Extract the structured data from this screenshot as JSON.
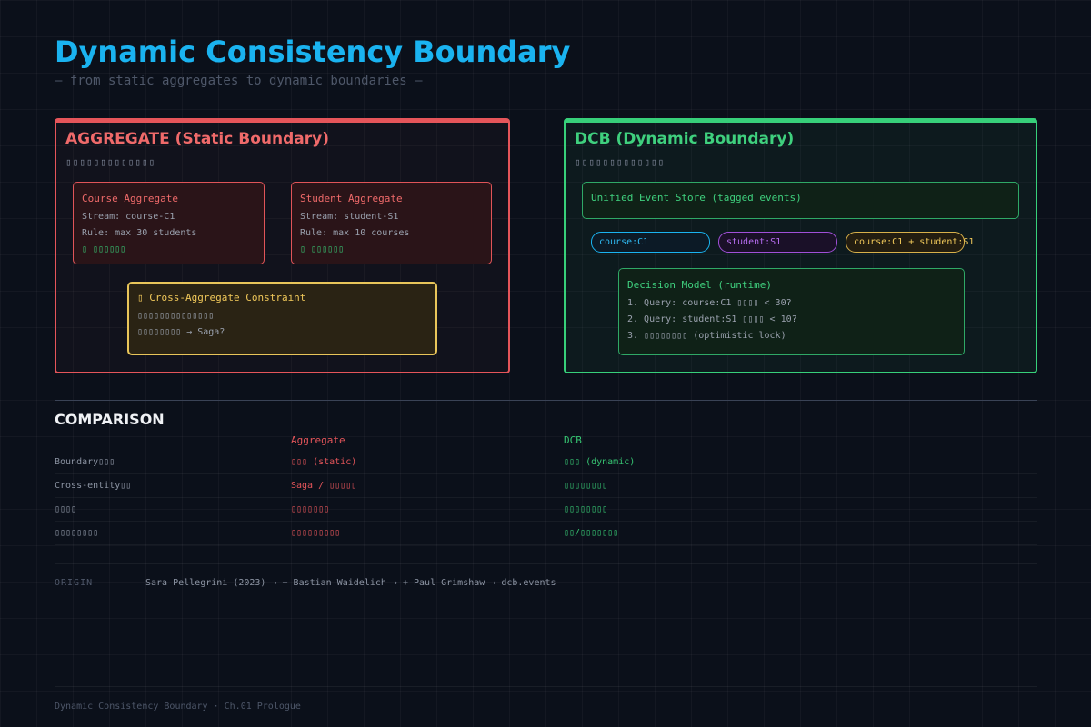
{
  "header": {
    "title": "Dynamic Consistency Boundary",
    "subtitle": "— from static aggregates to dynamic boundaries —"
  },
  "aggregate_panel": {
    "title": "AGGREGATE (Static Boundary)",
    "subtitle": "▯▯▯▯▯▯▯▯▯▯▯▯▯",
    "course": {
      "title": "Course Aggregate",
      "stream": "Stream: course-C1",
      "rule": "Rule: max 30 students",
      "status": "▯ ▯▯▯▯▯▯"
    },
    "student": {
      "title": "Student Aggregate",
      "stream": "Stream: student-S1",
      "rule": "Rule: max 10 courses",
      "status": "▯ ▯▯▯▯▯▯"
    },
    "constraint": {
      "title": "▯ Cross-Aggregate Constraint",
      "line1": "▯▯▯▯▯▯▯▯▯▯▯▯▯▯",
      "line2": "▯▯▯▯▯▯▯▯ → Saga?"
    }
  },
  "dcb_panel": {
    "title": "DCB (Dynamic Boundary)",
    "subtitle": "▯▯▯▯▯▯▯▯▯▯▯▯▯",
    "store": "Unified Event Store (tagged events)",
    "tags": [
      "course:C1",
      "student:S1",
      "course:C1 + student:S1"
    ],
    "decision": {
      "title": "Decision Model (runtime)",
      "step1": "1. Query: course:C1 ▯▯▯▯ < 30?",
      "step2": "2. Query: student:S1 ▯▯▯▯ < 10?",
      "step3": "3. ▯▯▯▯▯▯▯▯ (optimistic lock)"
    }
  },
  "comparison": {
    "title": "COMPARISON",
    "col_agg": "Aggregate",
    "col_dcb": "DCB",
    "rows": [
      {
        "label": "Boundary▯▯▯",
        "agg": "▯▯▯ (static)",
        "dcb": "▯▯▯ (dynamic)"
      },
      {
        "label": "Cross-entity▯▯",
        "agg": "Saga / ▯▯▯▯▯",
        "dcb": "▯▯▯▯▯▯▯▯"
      },
      {
        "label": "▯▯▯▯",
        "agg": "▯▯▯▯▯▯▯",
        "dcb": "▯▯▯▯▯▯▯▯"
      },
      {
        "label": "▯▯▯▯▯▯▯▯",
        "agg": "▯▯▯▯▯▯▯▯▯",
        "dcb": "▯▯/▯▯▯▯▯▯▯"
      }
    ]
  },
  "origin": {
    "label": "ORIGIN",
    "text": "Sara Pellegrini (2023) → + Bastian Waidelich → + Paul Grimshaw → dcb.events"
  },
  "footer": {
    "text": "Dynamic Consistency Boundary · Ch.01 Prologue"
  },
  "colors": {
    "accent": "#1ab3f0",
    "aggregate": "#e5555a",
    "dcb": "#37d07a",
    "constraint": "#e8c55a",
    "tag_student": "#a04fd8"
  }
}
